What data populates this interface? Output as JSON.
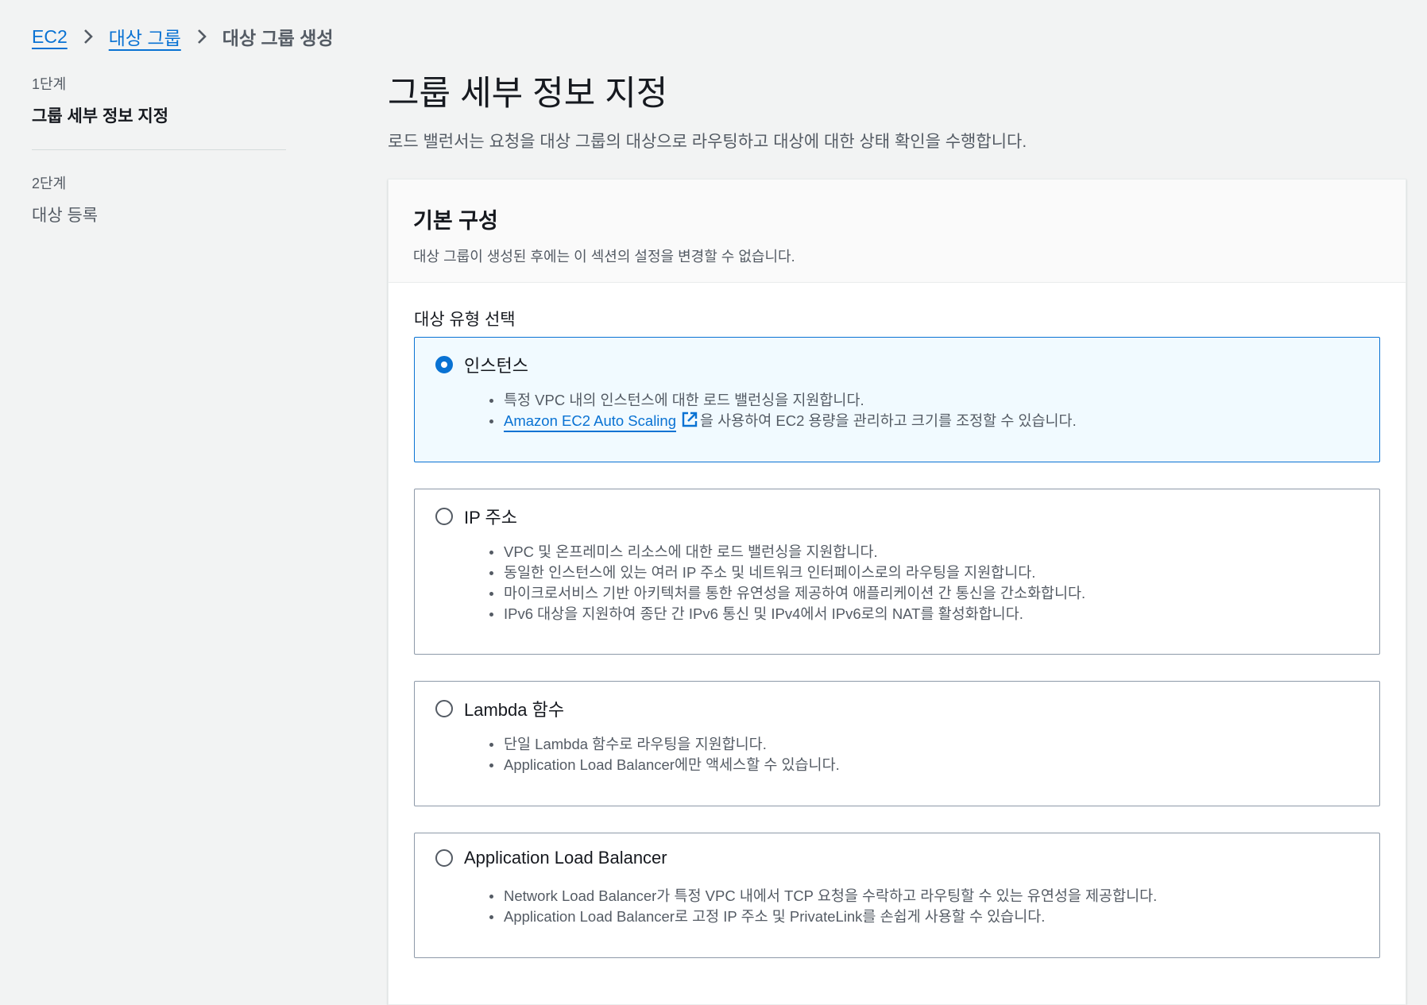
{
  "breadcrumb": {
    "items": [
      {
        "label": "EC2"
      },
      {
        "label": "대상 그룹"
      },
      {
        "label": "대상 그룹 생성"
      }
    ]
  },
  "steps": [
    {
      "number": "1단계",
      "title": "그룹 세부 정보 지정"
    },
    {
      "number": "2단계",
      "title": "대상 등록"
    }
  ],
  "page": {
    "title": "그룹 세부 정보 지정",
    "description": "로드 밸런서는 요청을 대상 그룹의 대상으로 라우팅하고 대상에 대한 상태 확인을 수행합니다."
  },
  "basic_config": {
    "title": "기본 구성",
    "description": "대상 그룹이 생성된 후에는 이 섹션의 설정을 변경할 수 없습니다.",
    "target_type_label": "대상 유형 선택",
    "options": [
      {
        "title": "인스턴스",
        "selected": true,
        "bullets": [
          "특정 VPC 내의 인스턴스에 대한 로드 밸런싱을 지원합니다.",
          "을 사용하여 EC2 용량을 관리하고 크기를 조정할 수 있습니다."
        ],
        "link_text": "Amazon EC2 Auto Scaling"
      },
      {
        "title": "IP 주소",
        "selected": false,
        "bullets": [
          "VPC 및 온프레미스 리소스에 대한 로드 밸런싱을 지원합니다.",
          "동일한 인스턴스에 있는 여러 IP 주소 및 네트워크 인터페이스로의 라우팅을 지원합니다.",
          "마이크로서비스 기반 아키텍처를 통한 유연성을 제공하여 애플리케이션 간 통신을 간소화합니다.",
          "IPv6 대상을 지원하여 종단 간 IPv6 통신 및 IPv4에서 IPv6로의 NAT를 활성화합니다."
        ]
      },
      {
        "title": "Lambda 함수",
        "selected": false,
        "bullets": [
          "단일 Lambda 함수로 라우팅을 지원합니다.",
          "Application Load Balancer에만 액세스할 수 있습니다."
        ]
      },
      {
        "title": "Application Load Balancer",
        "selected": false,
        "bullets": [
          "Network Load Balancer가 특정 VPC 내에서 TCP 요청을 수락하고 라우팅할 수 있는 유연성을 제공합니다.",
          "Application Load Balancer로 고정 IP 주소 및 PrivateLink를 손쉽게 사용할 수 있습니다."
        ]
      }
    ]
  },
  "colors": {
    "link": "#0972d3",
    "selected_bg": "#f1faff",
    "page_bg": "#f2f3f3"
  }
}
